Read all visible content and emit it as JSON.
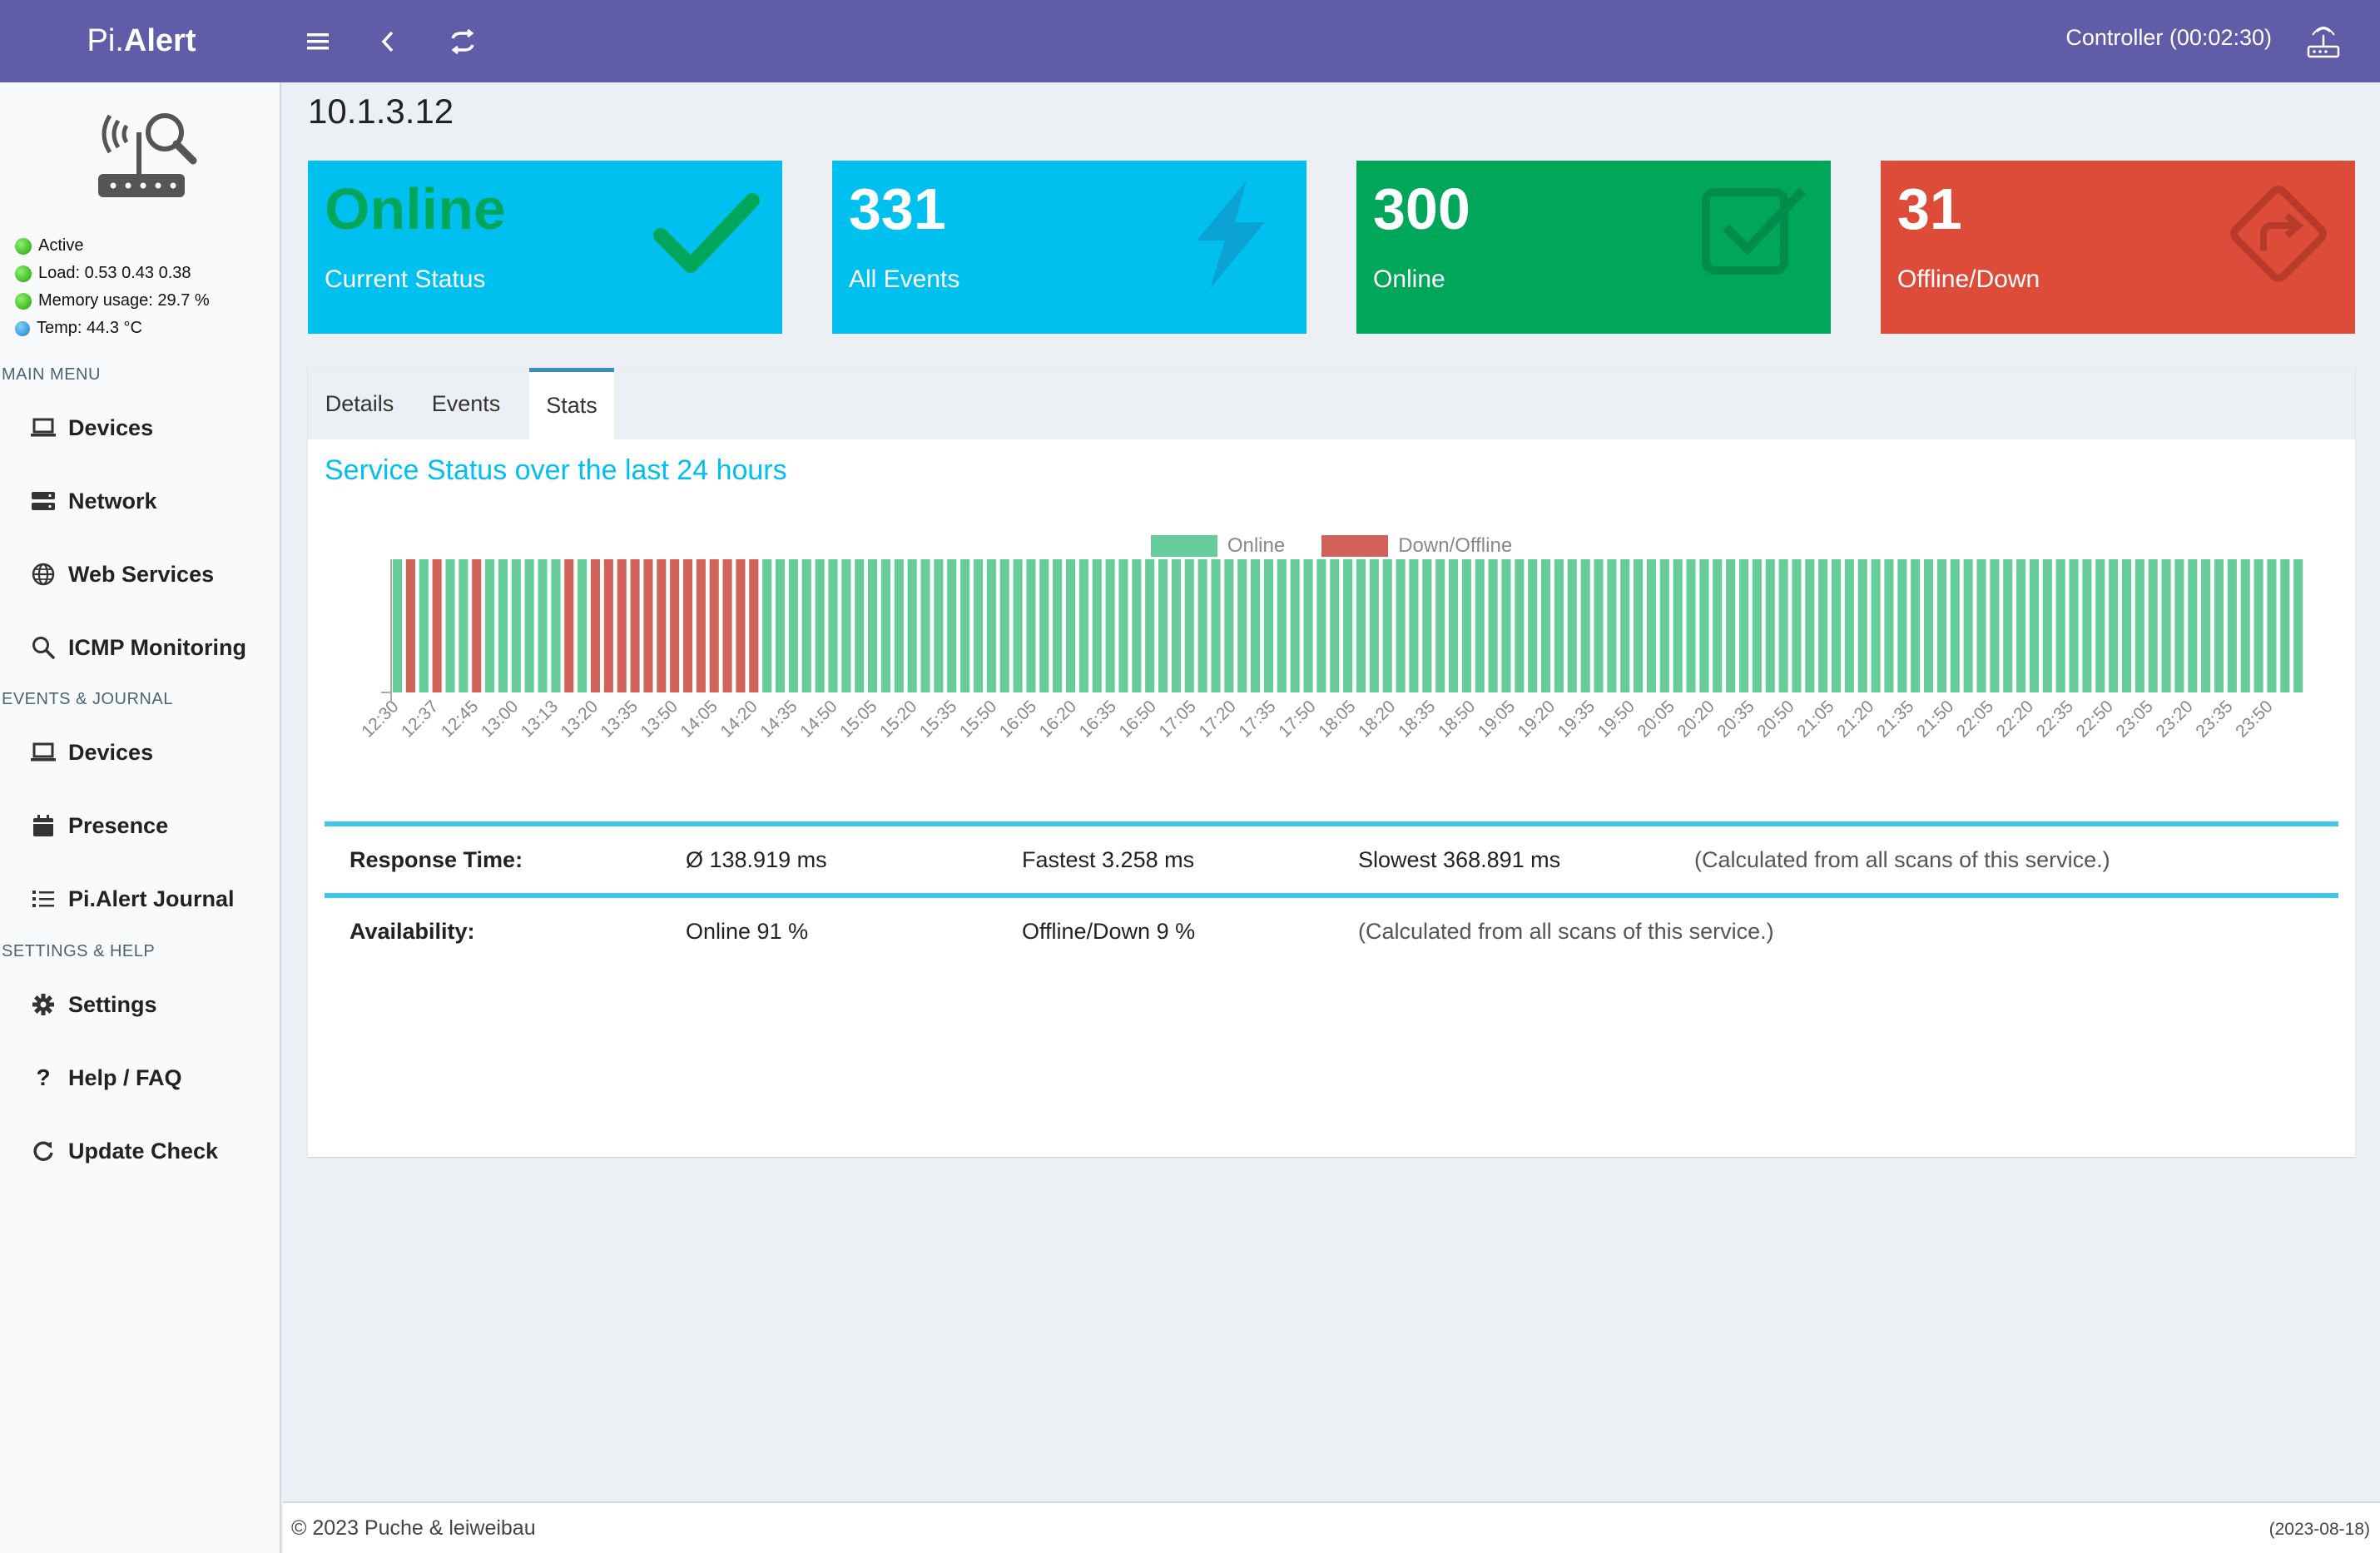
{
  "app": {
    "brand_prefix": "Pi.",
    "brand_name": "Alert"
  },
  "header": {
    "controller": "Controller (00:02:30)",
    "menu_icon": "menu-icon",
    "back_icon": "back-icon",
    "refresh_icon": "refresh-icon",
    "router_icon": "router-icon"
  },
  "sidebar": {
    "status": [
      "Active",
      "Load:  0.53  0.43  0.38",
      "Memory usage:  29.7 %",
      "Temp: 44.3 °C"
    ],
    "main_menu_label": "MAIN MENU",
    "main_menu": [
      "Devices",
      "Network",
      "Web Services",
      "ICMP Monitoring"
    ],
    "events_label": "EVENTS & JOURNAL",
    "events_menu": [
      "Devices",
      "Presence",
      "Pi.Alert Journal"
    ],
    "settings_label": "SETTINGS & HELP",
    "settings_menu": [
      "Settings",
      "Help / FAQ",
      "Update Check"
    ]
  },
  "page_title": "10.1.3.12",
  "boxes": [
    {
      "value": "Online",
      "label": "Current Status",
      "color": "#00c0ef"
    },
    {
      "value": "331",
      "label": "All Events",
      "color": "#00c0ef"
    },
    {
      "value": "300",
      "label": "Online",
      "color": "#00a65a"
    },
    {
      "value": "31",
      "label": "Offline/Down",
      "color": "#dd4b39"
    }
  ],
  "tabs": [
    "Details",
    "Events",
    "Stats"
  ],
  "active_tab": "Stats",
  "chart_title": "Service Status over the last 24 hours",
  "chart_data": {
    "type": "bar",
    "stacked": true,
    "legend": [
      "Online",
      "Down/Offline"
    ],
    "legend_position": "top-center",
    "colors": {
      "online": "#66cc99",
      "down": "#d1635a"
    },
    "x_tick_labels": [
      "12:30",
      "12:37",
      "12:45",
      "13:00",
      "13:13",
      "13:20",
      "13:35",
      "13:50",
      "14:05",
      "14:20",
      "14:35",
      "14:50",
      "15:05",
      "15:20",
      "15:35",
      "15:50",
      "16:05",
      "16:20",
      "16:35",
      "16:50",
      "17:05",
      "17:20",
      "17:35",
      "17:50",
      "18:05",
      "18:20",
      "18:35",
      "18:50",
      "19:05",
      "19:20",
      "19:35",
      "19:50",
      "20:05",
      "20:20",
      "20:35",
      "20:50",
      "21:05",
      "21:20",
      "21:35",
      "21:50",
      "22:05",
      "22:20",
      "22:35",
      "22:50",
      "23:05",
      "23:20",
      "23:35",
      "23:50"
    ],
    "bars": [
      0,
      1,
      0,
      1,
      0,
      0,
      1,
      0,
      0,
      0,
      0,
      0,
      0,
      1,
      0,
      1,
      1,
      1,
      1,
      1,
      1,
      1,
      1,
      1,
      1,
      1,
      1,
      1,
      0,
      0,
      0,
      0,
      0,
      0,
      0,
      0,
      0,
      0,
      0,
      0,
      0,
      0,
      0,
      0,
      0,
      0,
      0,
      0,
      0,
      0,
      0,
      0,
      0,
      0,
      0,
      0,
      0,
      0,
      0,
      0,
      0,
      0,
      0,
      0,
      0,
      0,
      0,
      0,
      0,
      0,
      0,
      0,
      0,
      0,
      0,
      0,
      0,
      0,
      0,
      0,
      0,
      0,
      0,
      0,
      0,
      0,
      0,
      0,
      0,
      0,
      0,
      0,
      0,
      0,
      0,
      0,
      0,
      0,
      0,
      0,
      0,
      0,
      0,
      0,
      0,
      0,
      0,
      0,
      0,
      0,
      0,
      0,
      0,
      0,
      0,
      0,
      0,
      0,
      0,
      0,
      0,
      0,
      0,
      0,
      0,
      0,
      0,
      0,
      0,
      0,
      0,
      0,
      0,
      0,
      0,
      0,
      0,
      0,
      0,
      0,
      0,
      0,
      0,
      0,
      0
    ],
    "bars_note_key": "1 = Down/Offline, 0 = Online; each bar is one scan"
  },
  "stats": {
    "response_label": "Response Time:",
    "response_avg": "Ø 138.919 ms",
    "response_fastest": "Fastest 3.258 ms",
    "response_slowest": "Slowest 368.891 ms",
    "response_note": "(Calculated from all scans of this service.)",
    "availability_label": "Availability:",
    "availability_online": "Online 91 %",
    "availability_offline": "Offline/Down 9 %",
    "availability_note": "(Calculated from all scans of this service.)"
  },
  "footer": {
    "copyright": "© 2023 Puche & leiweibau",
    "date": "(2023-08-18)"
  }
}
